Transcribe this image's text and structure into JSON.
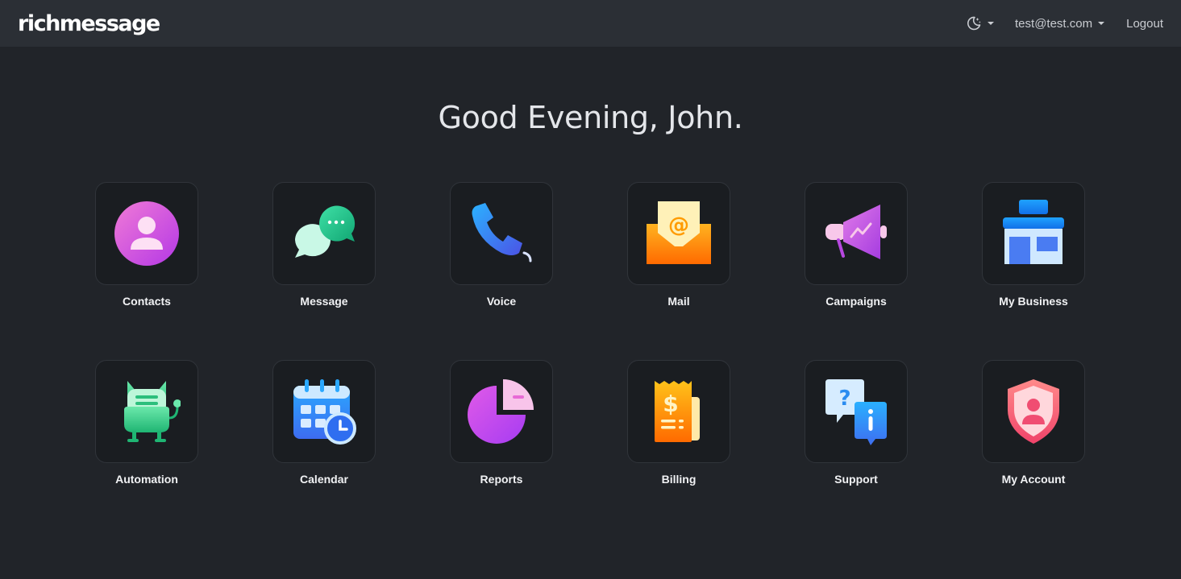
{
  "brand": {
    "name": "richmessage"
  },
  "nav": {
    "theme_icon": "moon-stars-icon",
    "user_email": "test@test.com",
    "logout_label": "Logout"
  },
  "greeting": "Good Evening, John.",
  "tiles": [
    {
      "label": "Contacts",
      "icon": "contacts-icon"
    },
    {
      "label": "Message",
      "icon": "chat-bubbles-icon"
    },
    {
      "label": "Voice",
      "icon": "phone-icon"
    },
    {
      "label": "Mail",
      "icon": "mail-envelope-icon"
    },
    {
      "label": "Campaigns",
      "icon": "megaphone-icon"
    },
    {
      "label": "My Business",
      "icon": "storefront-icon"
    },
    {
      "label": "Automation",
      "icon": "robot-icon"
    },
    {
      "label": "Calendar",
      "icon": "calendar-clock-icon"
    },
    {
      "label": "Reports",
      "icon": "pie-chart-icon"
    },
    {
      "label": "Billing",
      "icon": "receipt-icon"
    },
    {
      "label": "Support",
      "icon": "support-help-icon"
    },
    {
      "label": "My Account",
      "icon": "shield-user-icon"
    }
  ]
}
